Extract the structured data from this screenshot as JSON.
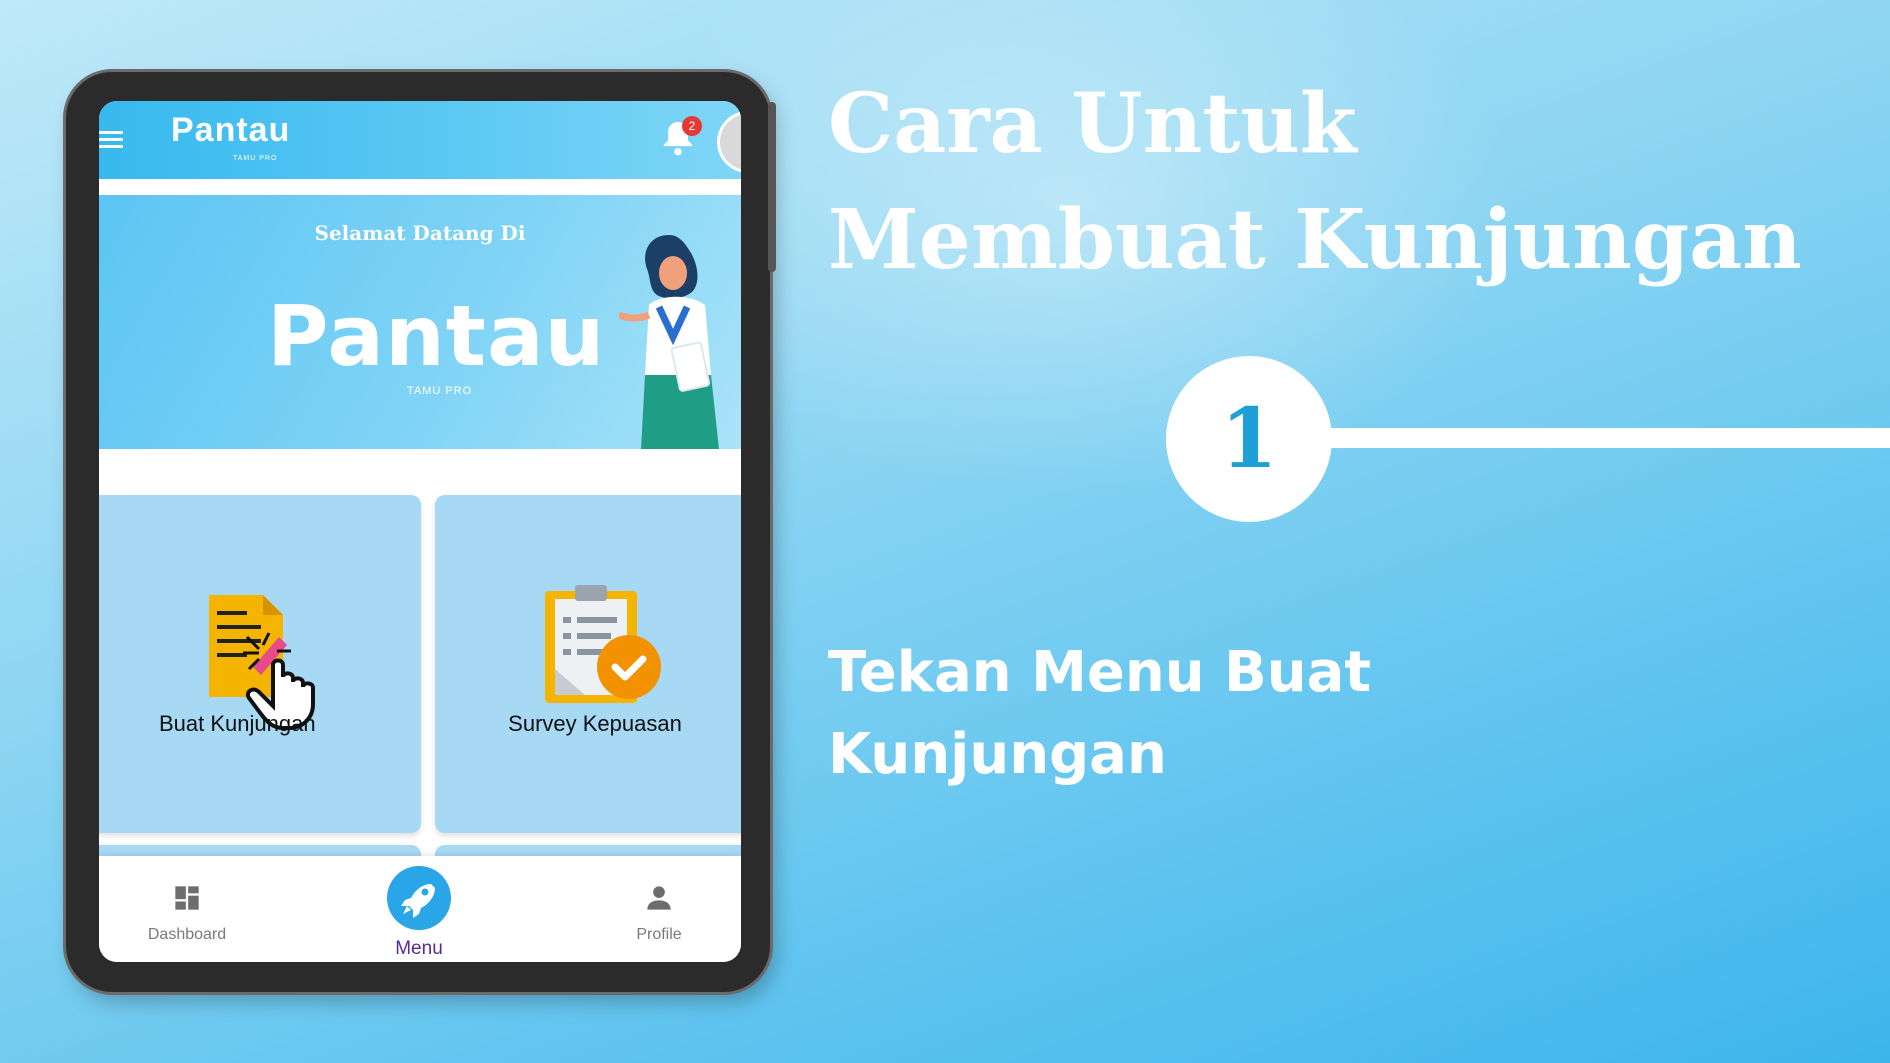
{
  "colors": {
    "accent": "#2aa5e8",
    "badge": "#e53935",
    "card": "#a7d8f4",
    "step_number": "#1e9fd8"
  },
  "app": {
    "logo": {
      "word": "Pantau",
      "sub": "TAMU PRO"
    },
    "notification_count": "2"
  },
  "hero": {
    "greeting": "Selamat Datang Di",
    "logo_word": "Pantau",
    "logo_sub": "TAMU PRO"
  },
  "cards": [
    {
      "label": "Buat Kunjungan",
      "icon": "document-edit-icon"
    },
    {
      "label": "Survey Kepuasan",
      "icon": "clipboard-check-icon"
    }
  ],
  "bottom_nav": {
    "items": [
      {
        "label": "Dashboard",
        "icon": "dashboard-icon"
      },
      {
        "label": "Menu",
        "icon": "rocket-icon"
      },
      {
        "label": "Profile",
        "icon": "person-icon"
      }
    ],
    "selected": "Menu"
  },
  "slide": {
    "title_line1": "Cara Untuk",
    "title_line2": "Membuat Kunjungan",
    "step_number": "1",
    "instruction_line1": "Tekan Menu Buat",
    "instruction_line2": "Kunjungan"
  }
}
